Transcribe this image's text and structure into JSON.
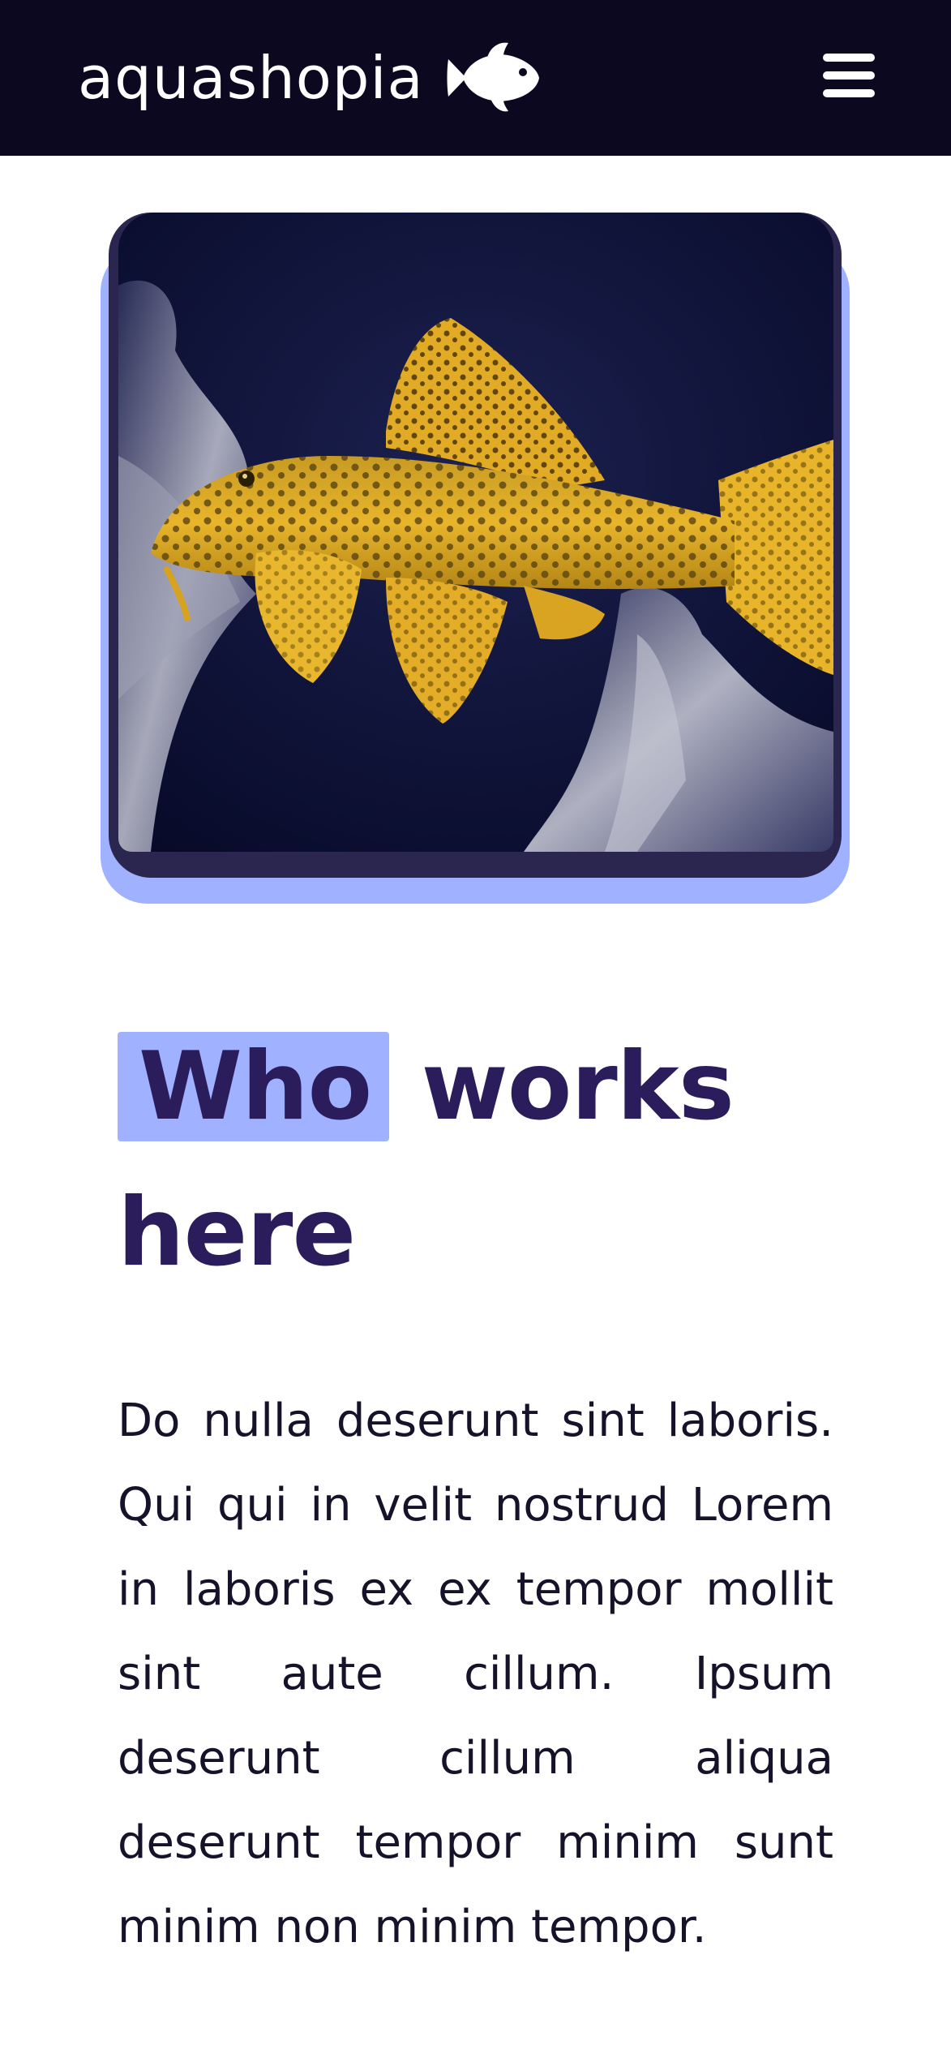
{
  "header": {
    "brand_name": "aquashopia",
    "logo_icon": "fish-icon",
    "menu_icon": "hamburger-menu-icon",
    "background_color": "#0b0820"
  },
  "hero": {
    "image_icon": "pleco-fish-photo",
    "accent_color": "#9fb1ff"
  },
  "section": {
    "heading_highlight": "Who",
    "heading_rest": " works here",
    "body": "Do nulla deserunt sint laboris. Qui qui in velit nostrud Lorem in laboris ex ex tempor mollit sint aute cillum. Ipsum deserunt cillum aliqua deserunt tempor minim sunt minim non minim tempor."
  },
  "colors": {
    "heading": "#2b1d5c",
    "highlight": "#9fb1ff",
    "text": "#15122a"
  }
}
